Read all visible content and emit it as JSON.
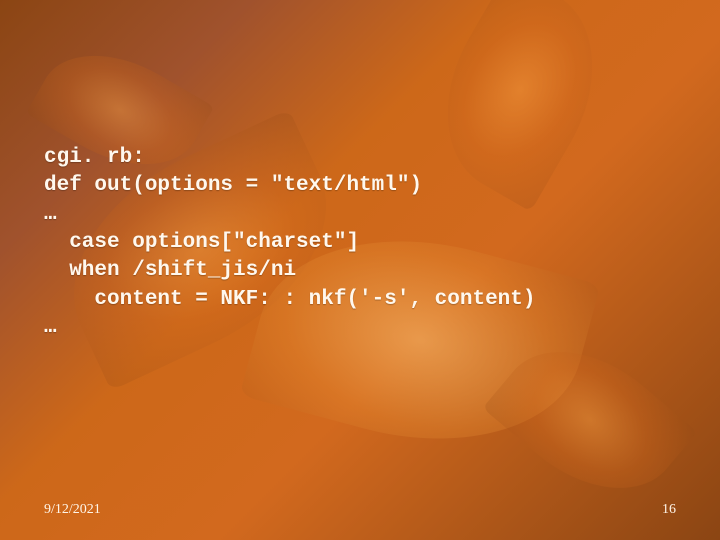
{
  "code": {
    "line1": "cgi. rb:",
    "line2": "def out(options = \"text/html\")",
    "line3": "…",
    "line4": "  case options[\"charset\"]",
    "line5": "  when /shift_jis/ni",
    "line6": "    content = NKF: : nkf('-s', content)",
    "line7": "…"
  },
  "footer": {
    "date": "9/12/2021",
    "page": "16"
  }
}
